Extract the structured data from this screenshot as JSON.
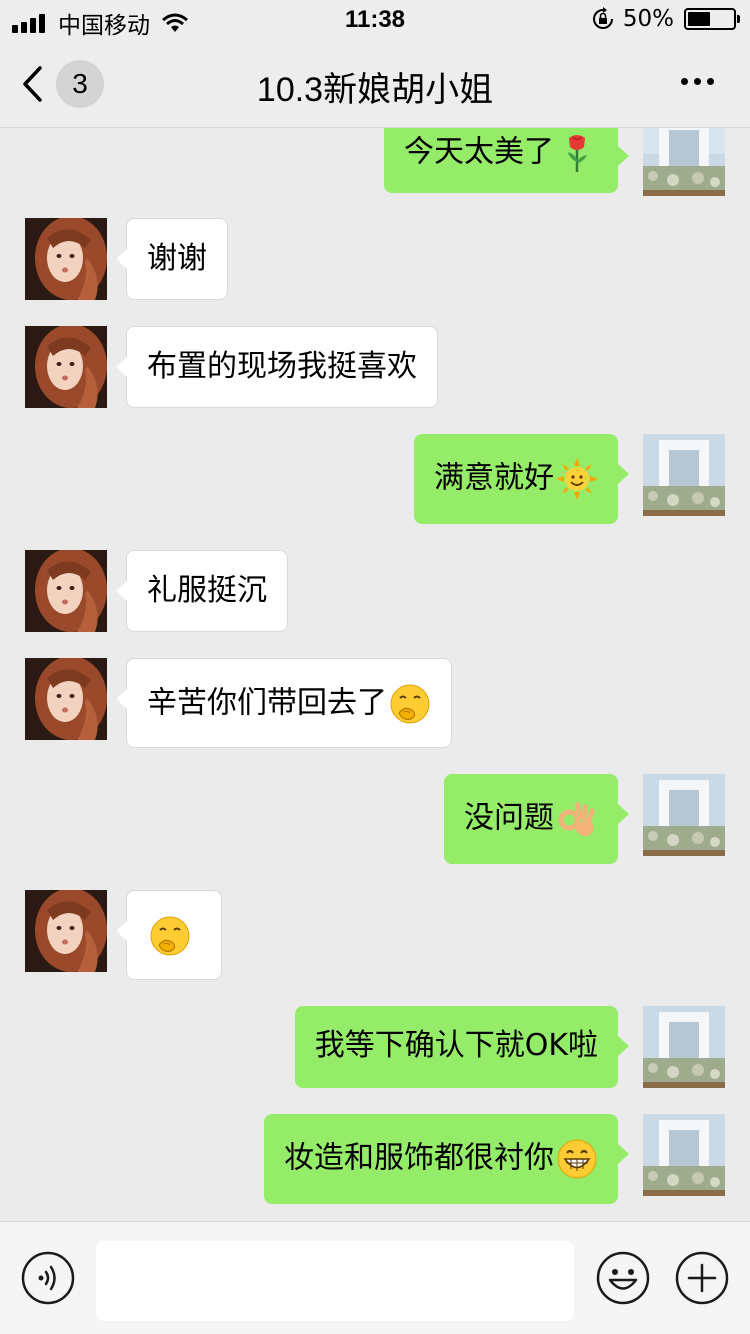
{
  "status_bar": {
    "carrier": "中国移动",
    "time": "11:38",
    "battery_text": "50%",
    "battery_level": 0.5,
    "icons": [
      "signal-icon",
      "wifi-icon",
      "rotation-lock-icon",
      "battery-icon"
    ]
  },
  "nav": {
    "title": "10.3新娘胡小姐",
    "unread_count": "3",
    "icons": [
      "back-chevron-icon",
      "more-icon"
    ]
  },
  "messages": [
    {
      "side": "right",
      "text": "今天太美了",
      "emoji": "rose-emoji-icon"
    },
    {
      "side": "left",
      "text": "谢谢",
      "emoji": null
    },
    {
      "side": "left",
      "text": "布置的现场我挺喜欢",
      "emoji": null
    },
    {
      "side": "right",
      "text": "满意就好",
      "emoji": "sun-emoji-icon"
    },
    {
      "side": "left",
      "text": "礼服挺沉",
      "emoji": null
    },
    {
      "side": "left",
      "text": "辛苦你们带回去了",
      "emoji": "chuckle-emoji-icon"
    },
    {
      "side": "right",
      "text": "没问题",
      "emoji": "ok-hand-emoji-icon"
    },
    {
      "side": "left",
      "text": "",
      "emoji": "chuckle-emoji-icon"
    },
    {
      "side": "right",
      "text": "我等下确认下就OK啦",
      "emoji": null
    },
    {
      "side": "right",
      "text": "妆造和服饰都很衬你",
      "emoji": "grin-emoji-icon"
    }
  ],
  "input_bar": {
    "value": "",
    "icons": [
      "voice-icon",
      "emoji-face-icon",
      "plus-icon"
    ]
  },
  "colors": {
    "outgoing_bubble": "#95ec69",
    "incoming_bubble": "#ffffff",
    "background": "#ebebeb"
  }
}
